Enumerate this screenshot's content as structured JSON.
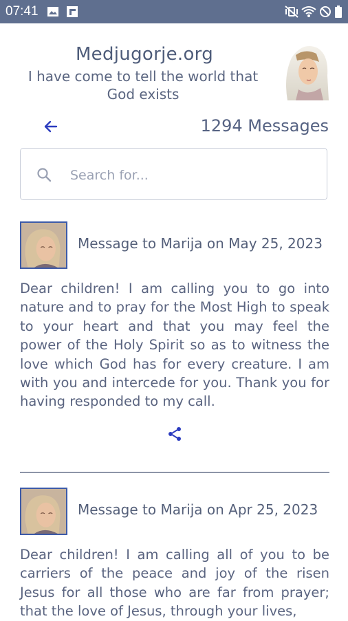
{
  "status_bar": {
    "time": "07:41",
    "left_icons": [
      "image-icon",
      "flipboard-icon"
    ],
    "right_icons": [
      "mute-vibrate-icon",
      "wifi-icon",
      "do-not-disturb-icon",
      "battery-icon"
    ]
  },
  "header": {
    "title": "Medjugorje.org",
    "tagline_line1": "I have come to tell the world that",
    "tagline_line2": "God exists",
    "portrait_icon": "mary-portrait"
  },
  "nav": {
    "back_icon": "arrow-left-icon",
    "count_label": "1294 Messages"
  },
  "search": {
    "placeholder": "Search for..."
  },
  "messages": [
    {
      "title": "Message to Marija on May 25, 2023",
      "body": "Dear children! I am calling you to go into nature and to pray for the Most High to speak to your heart and that you may feel the power of the Holy Spirit so as to witness the love which God has for every creature. I am with you and intercede for you. Thank you for having responded to my call.",
      "share_icon": "share-icon"
    },
    {
      "title": "Message to Marija on Apr 25, 2023",
      "body": "Dear children! I am calling all of you to be carriers of the peace and joy of the risen Jesus for all those who are far from prayer; that the love of Jesus, through your lives,"
    }
  ],
  "colors": {
    "status_bar": "#5f6f8f",
    "accent": "#2b3bbf",
    "text": "#55607a",
    "divider": "#8d95a8"
  }
}
